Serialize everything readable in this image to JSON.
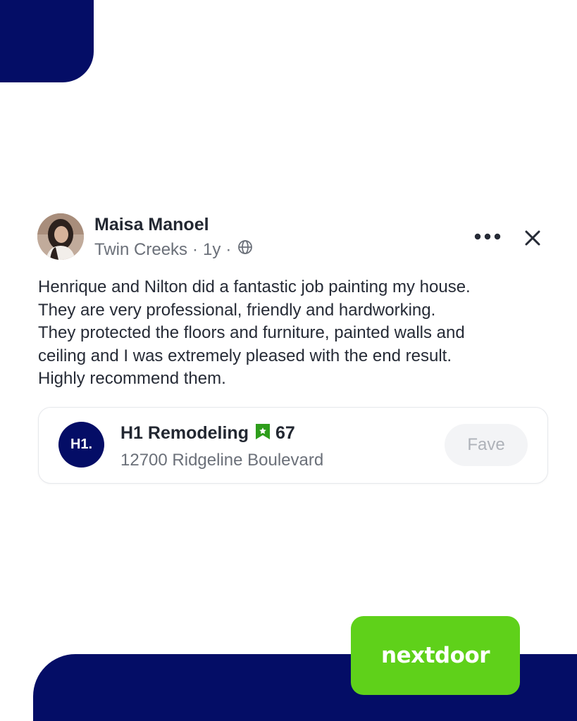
{
  "post": {
    "author_name": "Maisa Manoel",
    "neighborhood": "Twin Creeks",
    "separator": "·",
    "age": "1y",
    "visibility_icon": "globe-icon",
    "body_lines": [
      "Henrique and Nilton did a fantastic job painting my house.",
      "They are very professional, friendly and hardworking.",
      "They protected the floors and furniture, painted walls and",
      "ceiling and I was extremely pleased with the end result.",
      "Highly recommend them."
    ]
  },
  "actions": {
    "more_icon": "more-options-icon",
    "close_icon": "close-icon"
  },
  "business": {
    "logo_text": "H1.",
    "name": "H1 Remodeling",
    "fave_icon": "fave-ribbon-icon",
    "fave_count": "67",
    "address": "12700 Ridgeline Boulevard",
    "fave_button_label": "Fave"
  },
  "brand": {
    "wordmark": "nextdoor"
  },
  "colors": {
    "navy": "#040d66",
    "brand_green": "#5fd11a",
    "fave_green": "#2e9d1b",
    "text_primary": "#222731",
    "text_secondary": "#6b7079"
  }
}
